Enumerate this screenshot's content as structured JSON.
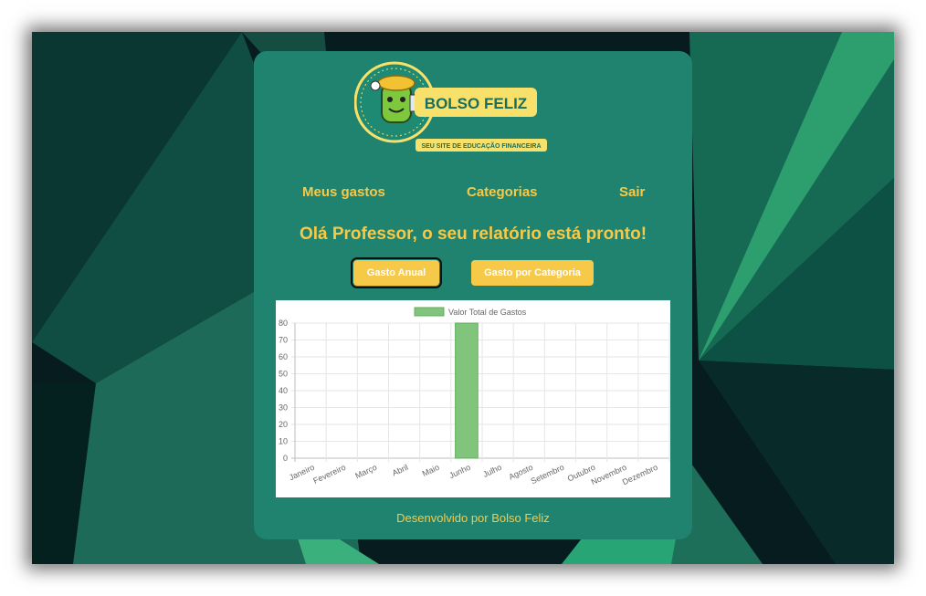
{
  "brand": {
    "logo_title": "BOLSO FELIZ",
    "logo_subtitle": "SEU SITE DE EDUCAÇÃO FINANCEIRA"
  },
  "nav": {
    "items": [
      {
        "label": "Meus gastos"
      },
      {
        "label": "Categorias"
      },
      {
        "label": "Sair"
      }
    ]
  },
  "main": {
    "heading": "Olá Professor, o seu relatório está pronto!",
    "buttons": {
      "annual": "Gasto Anual",
      "category": "Gasto por Categoria"
    }
  },
  "colors": {
    "card": "#208370",
    "accent": "#f7c948",
    "bar_fill": "#81c47c",
    "bar_border": "#5fae5a"
  },
  "chart_data": {
    "type": "bar",
    "legend": "Valor Total de Gastos",
    "legend_position": "top",
    "categories": [
      "Janeiro",
      "Fevereiro",
      "Março",
      "Abril",
      "Maio",
      "Junho",
      "Julho",
      "Agosto",
      "Setembro",
      "Outubro",
      "Novembro",
      "Dezembro"
    ],
    "values": [
      0,
      0,
      0,
      0,
      0,
      80,
      0,
      0,
      0,
      0,
      0,
      0
    ],
    "ylim": [
      0,
      80
    ],
    "yticks": [
      0,
      10,
      20,
      30,
      40,
      50,
      60,
      70,
      80
    ],
    "grid": true
  },
  "footer": {
    "text": "Desenvolvido por Bolso Feliz"
  }
}
